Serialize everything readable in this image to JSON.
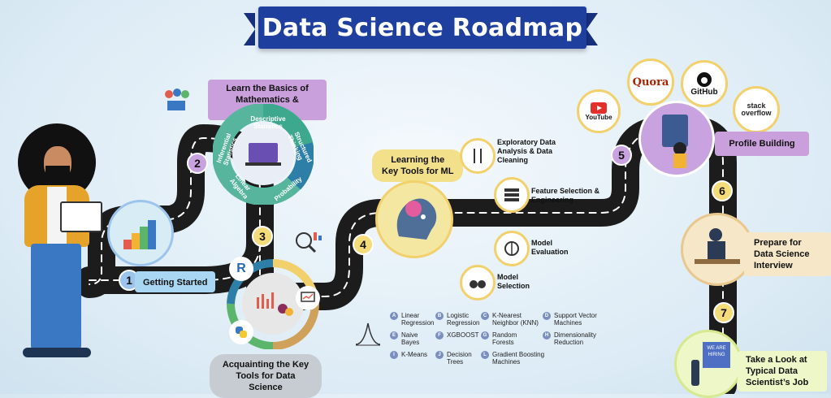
{
  "title": "Data Science Roadmap",
  "steps": {
    "s1": {
      "num": "1",
      "label": "Getting Started"
    },
    "s2": {
      "num": "2",
      "label_line1": "Learn the Basics of",
      "label_line2": "Mathematics & Statistics"
    },
    "s3": {
      "num": "3",
      "label_line1": "Acquainting the Key",
      "label_line2": "Tools for Data Science"
    },
    "s4": {
      "num": "4",
      "label_line1": "Learning the",
      "label_line2": "Key Tools for ML"
    },
    "s5": {
      "num": "5",
      "label": "Profile Building"
    },
    "s6": {
      "num": "6",
      "label_line1": "Prepare for",
      "label_line2": "Data Science",
      "label_line3": "Interview"
    },
    "s7": {
      "num": "7",
      "label_line1": "Take a Look at",
      "label_line2": "Typical Data",
      "label_line3": "Scientist’s Job"
    }
  },
  "math_wheel": {
    "segments": [
      "Descriptive Statistics",
      "Structured Thinking",
      "Probability",
      "Linear Algebra",
      "Inferential Statistics"
    ]
  },
  "ml_tools": [
    {
      "line1": "Exploratory Data",
      "line2": "Analysis & Data",
      "line3": "Cleaning"
    },
    {
      "line1": "Feature Selection &",
      "line2": "Engineering",
      "line3": ""
    },
    {
      "line1": "Model",
      "line2": "Evaluation",
      "line3": ""
    },
    {
      "line1": "Model",
      "line2": "Selection",
      "line3": ""
    }
  ],
  "models": [
    {
      "letter": "A",
      "line1": "Linear",
      "line2": "Regression"
    },
    {
      "letter": "B",
      "line1": "Logistic",
      "line2": "Regression"
    },
    {
      "letter": "C",
      "line1": "K-Nearest",
      "line2": "Neighbor (KNN)"
    },
    {
      "letter": "D",
      "line1": "Support Vector",
      "line2": "Machines"
    },
    {
      "letter": "E",
      "line1": "Naive",
      "line2": "Bayes"
    },
    {
      "letter": "F",
      "line1": "XGBOOST",
      "line2": ""
    },
    {
      "letter": "G",
      "line1": "Random",
      "line2": "Forests"
    },
    {
      "letter": "H",
      "line1": "Dimensionality",
      "line2": "Reduction"
    },
    {
      "letter": "I",
      "line1": "K-Means",
      "line2": ""
    },
    {
      "letter": "J",
      "line1": "Decision",
      "line2": "Trees"
    },
    {
      "letter": "L",
      "line1": "Gradient Boosting",
      "line2": "Machines"
    }
  ],
  "socials": {
    "youtube": "YouTube",
    "quora": "Quora",
    "github": "GitHub",
    "stack1": "stack",
    "stack2": "overflow"
  },
  "tools_logos": {
    "r": "R"
  },
  "badge": {
    "line1": "WE ARE",
    "line2": "HIRING"
  },
  "colors": {
    "banner": "#1f3f9e",
    "pill_purple": "#c9a0dc",
    "road": "#1c1c1c",
    "num_blue": "#9cc4ec",
    "num_purple": "#c8a3e0",
    "num_yellow": "#f5dc7a",
    "accent_gold": "#f2d06b"
  }
}
